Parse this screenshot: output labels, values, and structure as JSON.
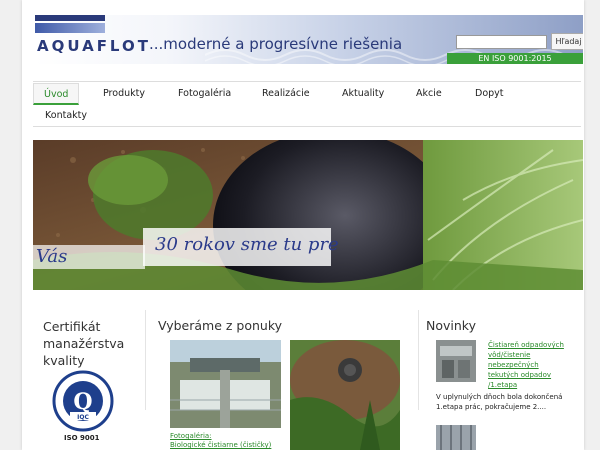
{
  "header": {
    "brand": "AQUAFLOT",
    "slogan": "...moderné a progresívne riešenia",
    "iso": "EN ISO 9001:2015",
    "search_placeholder": "",
    "search_button": "Hľadaj"
  },
  "nav": {
    "items": [
      "Úvod",
      "Produkty",
      "Fotogaléria",
      "Realizácie",
      "Aktuality",
      "Akcie",
      "Dopyt",
      "Kontakty"
    ]
  },
  "hero": {
    "line1": "30 rokov sme tu pre",
    "line2": "Vás"
  },
  "certificate": {
    "title": "Certifikát manažérstva kvality",
    "seal_caption": "ISO 9001"
  },
  "offer": {
    "title": "Vyberáme z ponuky",
    "gallery_link_line1": "Fotogaléria:",
    "gallery_link_line2": "Biologické čistiarne (čističky)"
  },
  "news": {
    "title": "Novinky",
    "item1_link_lines": [
      "Čistiareň odpadových",
      "vôd/čistenie",
      "nebezpečných",
      "tekutých odpadov",
      "/1.etapa"
    ],
    "item1_text_lines": [
      "V uplynulých dňoch bola dokončená",
      "1.etapa prác, pokračujeme 2...."
    ]
  },
  "colors": {
    "brand_blue": "#2a3a7a",
    "accent_green": "#3aa03a",
    "link_green": "#2a8a2a"
  }
}
